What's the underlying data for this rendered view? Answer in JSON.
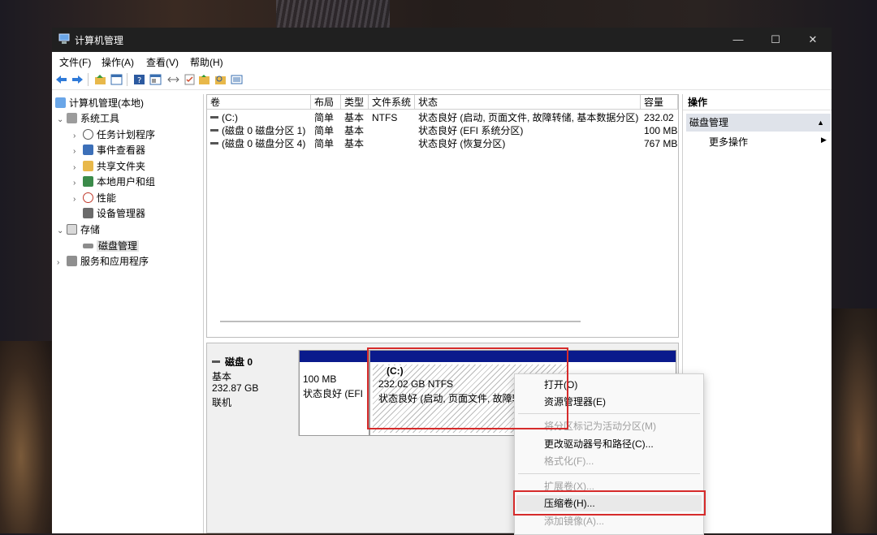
{
  "colors": {
    "titlebar": "#202020",
    "partition_bar": "#0a1a8c",
    "highlight_box": "#d62b2b",
    "selection": "#e5e5e5"
  },
  "window": {
    "title": "计算机管理",
    "minimize": "—",
    "maximize": "☐",
    "close": "✕"
  },
  "menu": [
    "文件(F)",
    "操作(A)",
    "查看(V)",
    "帮助(H)"
  ],
  "toolbar_icons": [
    "back-icon",
    "forward-icon",
    "up-folder-icon",
    "show-hide-tree-icon",
    "help-icon",
    "properties-icon",
    "connect-icon",
    "checklist-icon",
    "rescan-icon",
    "search-icon",
    "list-icon"
  ],
  "tree": {
    "root": "计算机管理(本地)",
    "system_tools": "系统工具",
    "task_scheduler": "任务计划程序",
    "event_viewer": "事件查看器",
    "shared_folders": "共享文件夹",
    "local_users": "本地用户和组",
    "performance": "性能",
    "device_manager": "设备管理器",
    "storage": "存储",
    "disk_management": "磁盘管理",
    "services_apps": "服务和应用程序"
  },
  "volume_table": {
    "headers": [
      "卷",
      "布局",
      "类型",
      "文件系统",
      "状态",
      "容量"
    ],
    "rows": [
      {
        "volume": "(C:)",
        "layout": "简单",
        "type": "基本",
        "fs": "NTFS",
        "status": "状态良好 (启动, 页面文件, 故障转储, 基本数据分区)",
        "capacity": "232.02"
      },
      {
        "volume": "(磁盘 0 磁盘分区 1)",
        "layout": "简单",
        "type": "基本",
        "fs": "",
        "status": "状态良好 (EFI 系统分区)",
        "capacity": "100 MB"
      },
      {
        "volume": "(磁盘 0 磁盘分区 4)",
        "layout": "简单",
        "type": "基本",
        "fs": "",
        "status": "状态良好 (恢复分区)",
        "capacity": "767 MB"
      }
    ]
  },
  "disk": {
    "name": "磁盘 0",
    "type": "基本",
    "size": "232.87 GB",
    "state": "联机",
    "partitions": [
      {
        "size": "100 MB",
        "status": "状态良好 (EFI"
      },
      {
        "label": "(C:)",
        "size": "232.02 GB NTFS",
        "status": "状态良好 (启动, 页面文件, 故障转"
      }
    ]
  },
  "actions": {
    "header": "操作",
    "section": "磁盘管理",
    "more": "更多操作",
    "collapse": "▲",
    "more_arrow": "▶"
  },
  "context_menu": {
    "open": "打开(O)",
    "explorer": "资源管理器(E)",
    "mark_active": "将分区标记为活动分区(M)",
    "change_letter": "更改驱动器号和路径(C)...",
    "format": "格式化(F)...",
    "extend": "扩展卷(X)...",
    "shrink": "压缩卷(H)...",
    "add_mirror": "添加镜像(A)..."
  }
}
